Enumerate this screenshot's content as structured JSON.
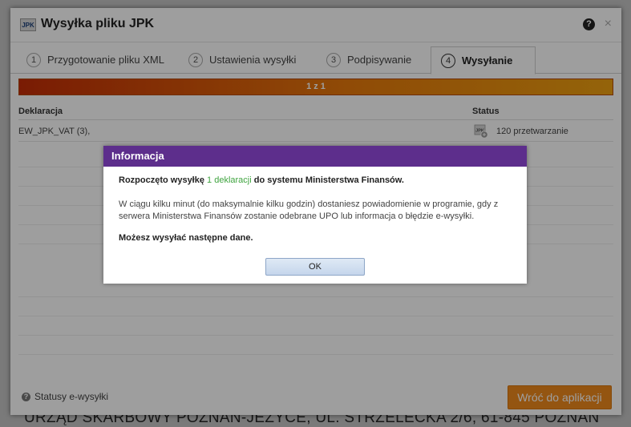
{
  "background": {
    "bottom_text": "URZĄD SKARBOWY POZNAŃ-JEŻYCE, UL. STRZELECKA 2/6, 61-845 POZNAŃ"
  },
  "dialog": {
    "logo": "JPK",
    "title": "Wysyłka pliku JPK",
    "help_icon": "?",
    "close_icon": "×",
    "tabs": [
      {
        "num": "1",
        "label": "Przygotowanie pliku XML"
      },
      {
        "num": "2",
        "label": "Ustawienia wysyłki"
      },
      {
        "num": "3",
        "label": "Podpisywanie"
      },
      {
        "num": "4",
        "label": "Wysyłanie"
      }
    ],
    "progress_label": "1 z 1",
    "table": {
      "headers": {
        "declaration": "Deklaracja",
        "status": "Status"
      },
      "rows": [
        {
          "declaration": "EW_JPK_VAT (3),",
          "status": "120 przetwarzanie"
        }
      ]
    },
    "footer": {
      "help_link": "Statusy e-wysyłki",
      "back_button": "Wróć do aplikacji"
    }
  },
  "info_dialog": {
    "title": "Informacja",
    "p1_before": "Rozpoczęto wysyłkę ",
    "p1_highlight": "1 deklaracji",
    "p1_after": " do systemu Ministerstwa Finansów.",
    "p2": "W ciągu kilku minut (do maksymalnie kilku godzin) dostaniesz powiadomienie w programie, gdy z serwera Ministerstwa Finansów zostanie odebrane UPO lub informacja o błędzie e-wysyłki.",
    "p3": "Możesz wysyłać następne dane.",
    "ok_button": "OK"
  },
  "colors": {
    "info_header": "#5d2e8c",
    "highlight": "#3fa43f",
    "back_button": "#ef8a1c",
    "progress_start": "#c52d08",
    "progress_end": "#efa111"
  }
}
